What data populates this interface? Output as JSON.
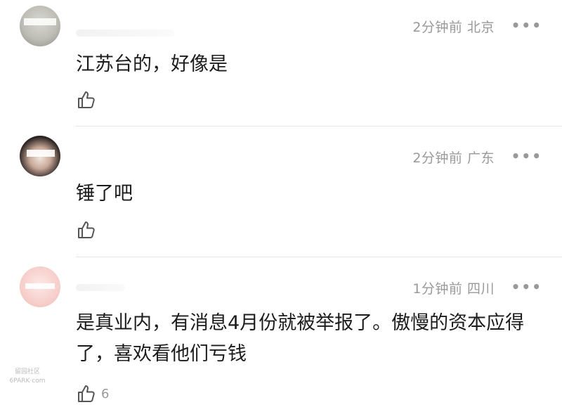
{
  "comments": [
    {
      "time": "2分钟前",
      "location": "北京",
      "text": "江苏台的，好像是",
      "likes": ""
    },
    {
      "time": "2分钟前",
      "location": "广东",
      "text": "锤了吧",
      "likes": ""
    },
    {
      "time": "1分钟前",
      "location": "四川",
      "text": "是真业内，有消息4月份就被举报了。傲慢的资本应得了，喜欢看他们亏钱",
      "likes": "6"
    }
  ],
  "watermark": {
    "line1": "留园社区",
    "line2": "6PARK·com"
  },
  "icons": {
    "like": "thumbs-up-icon",
    "more": "more-dots-icon"
  },
  "colors": {
    "meta": "#999999",
    "text": "#1c1c1c",
    "divider": "#e6e6e6"
  }
}
